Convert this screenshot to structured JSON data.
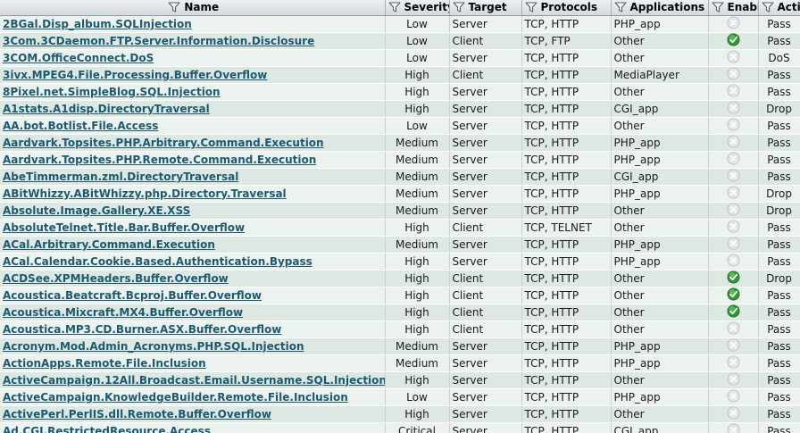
{
  "columns": {
    "name": "Name",
    "severity": "Severity",
    "target": "Target",
    "protocols": "Protocols",
    "applications": "Applications",
    "enable": "Enable",
    "action": "Action"
  },
  "icons": {
    "filter": "filter-icon",
    "enabled": "check-icon",
    "disabled": "disabled-icon"
  },
  "colors": {
    "link": "#1d5a72",
    "row_light": "#ecf3ef",
    "row_dark": "#dde8e2",
    "enabled_green": "#2f9a2f"
  },
  "rows": [
    {
      "name": "2BGal.Disp_album.SQLInjection",
      "severity": "Low",
      "target": "Server",
      "protocols": "TCP, HTTP",
      "applications": "PHP_app",
      "enabled": false,
      "action": "Pass"
    },
    {
      "name": "3Com.3CDaemon.FTP.Server.Information.Disclosure",
      "severity": "Low",
      "target": "Client",
      "protocols": "TCP, FTP",
      "applications": "Other",
      "enabled": true,
      "action": "Pass"
    },
    {
      "name": "3COM.OfficeConnect.DoS",
      "severity": "Low",
      "target": "Server",
      "protocols": "TCP, HTTP",
      "applications": "Other",
      "enabled": false,
      "action": "DoS"
    },
    {
      "name": "3ivx.MPEG4.File.Processing.Buffer.Overflow",
      "severity": "High",
      "target": "Client",
      "protocols": "TCP, HTTP",
      "applications": "MediaPlayer",
      "enabled": false,
      "action": "Pass"
    },
    {
      "name": "8Pixel.net.SimpleBlog.SQL.Injection",
      "severity": "High",
      "target": "Server",
      "protocols": "TCP, HTTP",
      "applications": "Other",
      "enabled": false,
      "action": "Pass"
    },
    {
      "name": "A1stats.A1disp.DirectoryTraversal",
      "severity": "High",
      "target": "Server",
      "protocols": "TCP, HTTP",
      "applications": "CGI_app",
      "enabled": false,
      "action": "Drop"
    },
    {
      "name": "AA.bot.Botlist.File.Access",
      "severity": "Low",
      "target": "Server",
      "protocols": "TCP, HTTP",
      "applications": "Other",
      "enabled": false,
      "action": "Pass"
    },
    {
      "name": "Aardvark.Topsites.PHP.Arbitrary.Command.Execution",
      "severity": "Medium",
      "target": "Server",
      "protocols": "TCP, HTTP",
      "applications": "PHP_app",
      "enabled": false,
      "action": "Pass"
    },
    {
      "name": "Aardvark.Topsites.PHP.Remote.Command.Execution",
      "severity": "Medium",
      "target": "Server",
      "protocols": "TCP, HTTP",
      "applications": "PHP_app",
      "enabled": false,
      "action": "Pass"
    },
    {
      "name": "AbeTimmerman.zml.DirectoryTraversal",
      "severity": "Medium",
      "target": "Server",
      "protocols": "TCP, HTTP",
      "applications": "CGI_app",
      "enabled": false,
      "action": "Pass"
    },
    {
      "name": "ABitWhizzy.ABitWhizzy.php.Directory.Traversal",
      "severity": "Medium",
      "target": "Server",
      "protocols": "TCP, HTTP",
      "applications": "PHP_app",
      "enabled": false,
      "action": "Drop"
    },
    {
      "name": "Absolute.Image.Gallery.XE.XSS",
      "severity": "Medium",
      "target": "Server",
      "protocols": "TCP, HTTP",
      "applications": "Other",
      "enabled": false,
      "action": "Drop"
    },
    {
      "name": "AbsoluteTelnet.Title.Bar.Buffer.Overflow",
      "severity": "High",
      "target": "Client",
      "protocols": "TCP, TELNET",
      "applications": "Other",
      "enabled": false,
      "action": "Pass"
    },
    {
      "name": "ACal.Arbitrary.Command.Execution",
      "severity": "Medium",
      "target": "Server",
      "protocols": "TCP, HTTP",
      "applications": "PHP_app",
      "enabled": false,
      "action": "Pass"
    },
    {
      "name": "ACal.Calendar.Cookie.Based.Authentication.Bypass",
      "severity": "High",
      "target": "Server",
      "protocols": "TCP, HTTP",
      "applications": "PHP_app",
      "enabled": false,
      "action": "Pass"
    },
    {
      "name": "ACDSee.XPMHeaders.Buffer.Overflow",
      "severity": "High",
      "target": "Client",
      "protocols": "TCP, HTTP",
      "applications": "Other",
      "enabled": true,
      "action": "Drop"
    },
    {
      "name": "Acoustica.Beatcraft.Bcproj.Buffer.Overflow",
      "severity": "High",
      "target": "Client",
      "protocols": "TCP, HTTP",
      "applications": "Other",
      "enabled": true,
      "action": "Pass"
    },
    {
      "name": "Acoustica.Mixcraft.MX4.Buffer.Overflow",
      "severity": "High",
      "target": "Client",
      "protocols": "TCP, HTTP",
      "applications": "Other",
      "enabled": true,
      "action": "Pass"
    },
    {
      "name": "Acoustica.MP3.CD.Burner.ASX.Buffer.Overflow",
      "severity": "High",
      "target": "Client",
      "protocols": "TCP, HTTP",
      "applications": "Other",
      "enabled": false,
      "action": "Pass"
    },
    {
      "name": "Acronym.Mod.Admin_Acronyms.PHP.SQL.Injection",
      "severity": "Medium",
      "target": "Server",
      "protocols": "TCP, HTTP",
      "applications": "PHP_app",
      "enabled": false,
      "action": "Pass"
    },
    {
      "name": "ActionApps.Remote.File.Inclusion",
      "severity": "Medium",
      "target": "Server",
      "protocols": "TCP, HTTP",
      "applications": "PHP_app",
      "enabled": false,
      "action": "Pass"
    },
    {
      "name": "ActiveCampaign.12All.Broadcast.Email.Username.SQL.Injection",
      "severity": "High",
      "target": "Server",
      "protocols": "TCP, HTTP",
      "applications": "Other",
      "enabled": false,
      "action": "Pass"
    },
    {
      "name": "ActiveCampaign.KnowledgeBuilder.Remote.File.Inclusion",
      "severity": "Low",
      "target": "Server",
      "protocols": "TCP, HTTP",
      "applications": "PHP_app",
      "enabled": false,
      "action": "Pass"
    },
    {
      "name": "ActivePerl.PerlIS.dll.Remote.Buffer.Overflow",
      "severity": "High",
      "target": "Server",
      "protocols": "TCP, HTTP",
      "applications": "Other",
      "enabled": false,
      "action": "Pass"
    },
    {
      "name": "Ad.CGI.RestrictedResource.Access",
      "severity": "Critical",
      "target": "Server",
      "protocols": "TCP, HTTP",
      "applications": "CGI_app",
      "enabled": false,
      "action": "Pass"
    }
  ]
}
